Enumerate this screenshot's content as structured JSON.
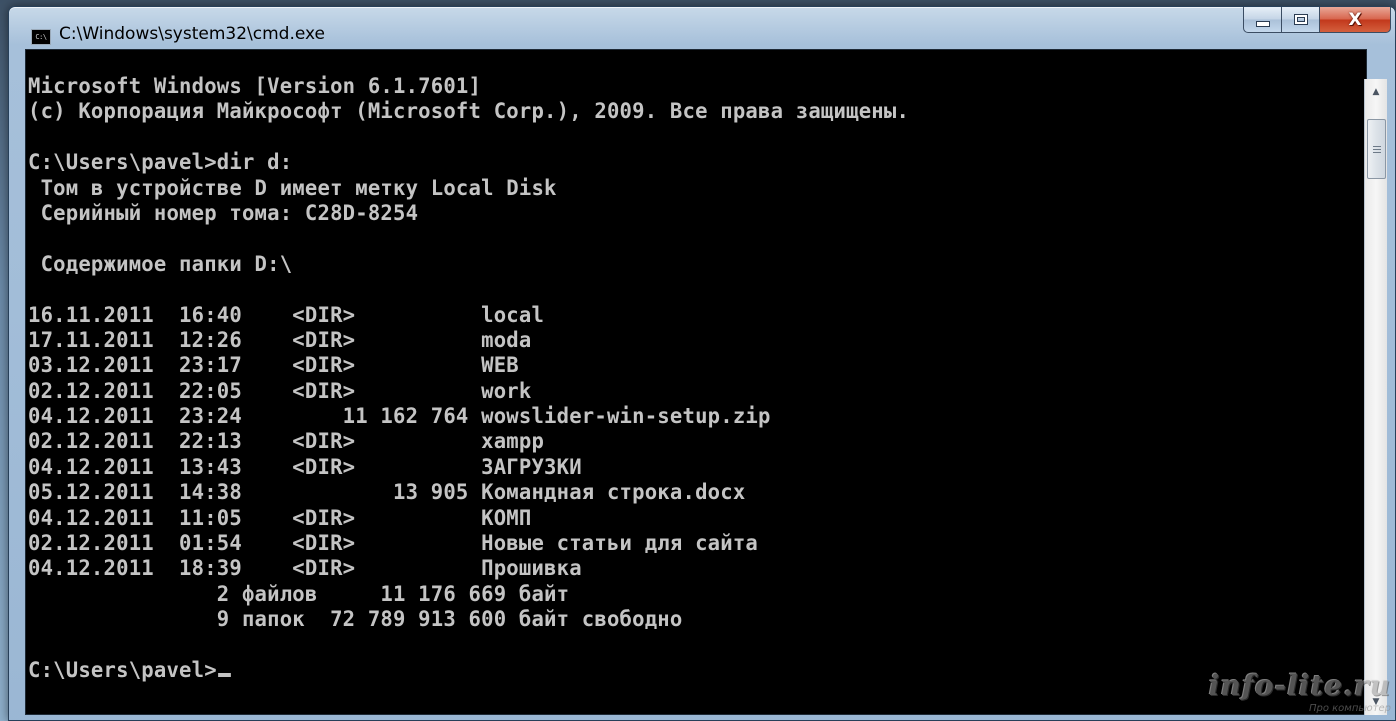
{
  "window": {
    "title": "C:\\Windows\\system32\\cmd.exe",
    "icon_label": "C:\\",
    "icon_name": "cmd-icon",
    "buttons": {
      "minimize_icon": "minimize-icon",
      "maximize_icon": "maximize-icon",
      "close_glyph": "X"
    }
  },
  "console": {
    "lines": [
      "Microsoft Windows [Version 6.1.7601]",
      "(c) Корпорация Майкрософт (Microsoft Corp.), 2009. Все права защищены.",
      "",
      "C:\\Users\\pavel>dir d:",
      " Том в устройстве D имеет метку Local Disk",
      " Серийный номер тома: C28D-8254",
      "",
      " Содержимое папки D:\\",
      "",
      "16.11.2011  16:40    <DIR>          local",
      "17.11.2011  12:26    <DIR>          moda",
      "03.12.2011  23:17    <DIR>          WEB",
      "02.12.2011  22:05    <DIR>          work",
      "04.12.2011  23:24        11 162 764 wowslider-win-setup.zip",
      "02.12.2011  22:13    <DIR>          xampp",
      "04.12.2011  13:43    <DIR>          ЗАГРУЗКИ",
      "05.12.2011  14:38            13 905 Командная строка.docx",
      "04.12.2011  11:05    <DIR>          КОМП",
      "02.12.2011  01:54    <DIR>          Новые статьи для сайта",
      "04.12.2011  18:39    <DIR>          Прошивка",
      "               2 файлов     11 176 669 байт",
      "               9 папок  72 789 913 600 байт свободно",
      ""
    ],
    "prompt": "C:\\Users\\pavel>"
  },
  "watermark": {
    "main": "info-lite.ru",
    "sub": "Про компьютер"
  },
  "colors": {
    "console_bg": "#000000",
    "console_fg": "#c4c4c4",
    "close_button": "#c2381c"
  }
}
